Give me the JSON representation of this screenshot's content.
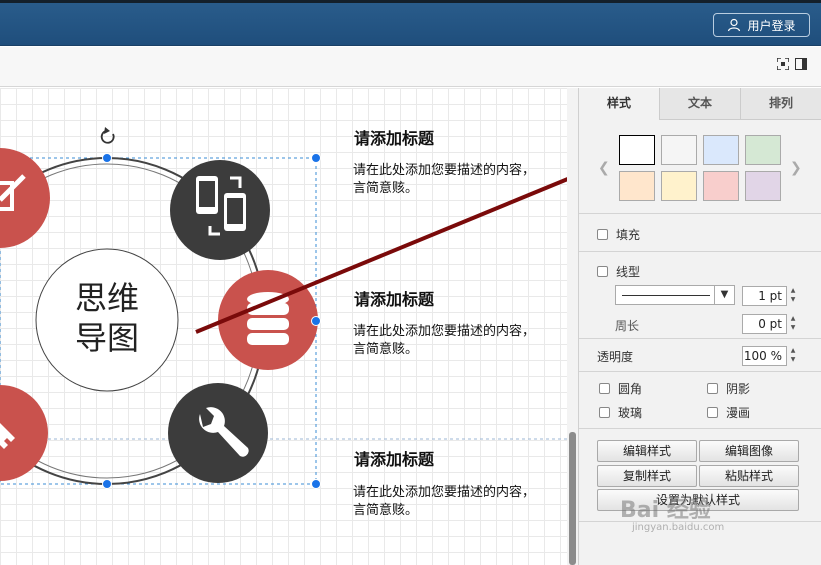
{
  "header": {
    "login_label": "用户登录"
  },
  "diagram": {
    "center_text_line1": "思维",
    "center_text_line2": "导图",
    "items": [
      {
        "title": "请添加标题",
        "desc": "请在此处添加您要描述的内容，言简意赅。"
      },
      {
        "title": "请添加标题",
        "desc": "请在此处添加您要描述的内容，言简意赅。"
      },
      {
        "title": "请添加标题",
        "desc": "请在此处添加您要描述的内容，言简意赅。"
      }
    ]
  },
  "panel": {
    "tabs": [
      "样式",
      "文本",
      "排列"
    ],
    "swatches": [
      "#ffffff",
      "#f5f5f5",
      "#dae8fc",
      "#d5e8d4",
      "#ffe6cc",
      "#fff2cc",
      "#f8cecc",
      "#e1d5e7"
    ],
    "fill_label": "填充",
    "line_label": "线型",
    "line_width": "1 pt",
    "perimeter_label": "周长",
    "perimeter_value": "0 pt",
    "opacity_label": "透明度",
    "opacity_value": "100 %",
    "rounded_label": "圆角",
    "shadow_label": "阴影",
    "glass_label": "玻璃",
    "sketch_label": "漫画",
    "buttons": {
      "edit_style": "编辑样式",
      "edit_image": "编辑图像",
      "copy_style": "复制样式",
      "paste_style": "粘贴样式",
      "set_default": "设置为默认样式"
    }
  },
  "watermark": {
    "brand": "Bai 经验",
    "url": "jingyan.baidu.com"
  },
  "colors": {
    "header": "#1f4e7c",
    "red_node": "#c9524d",
    "dark_node": "#3c3c3c",
    "arrow": "#7a0a0a",
    "selection": "#1a73e8"
  }
}
